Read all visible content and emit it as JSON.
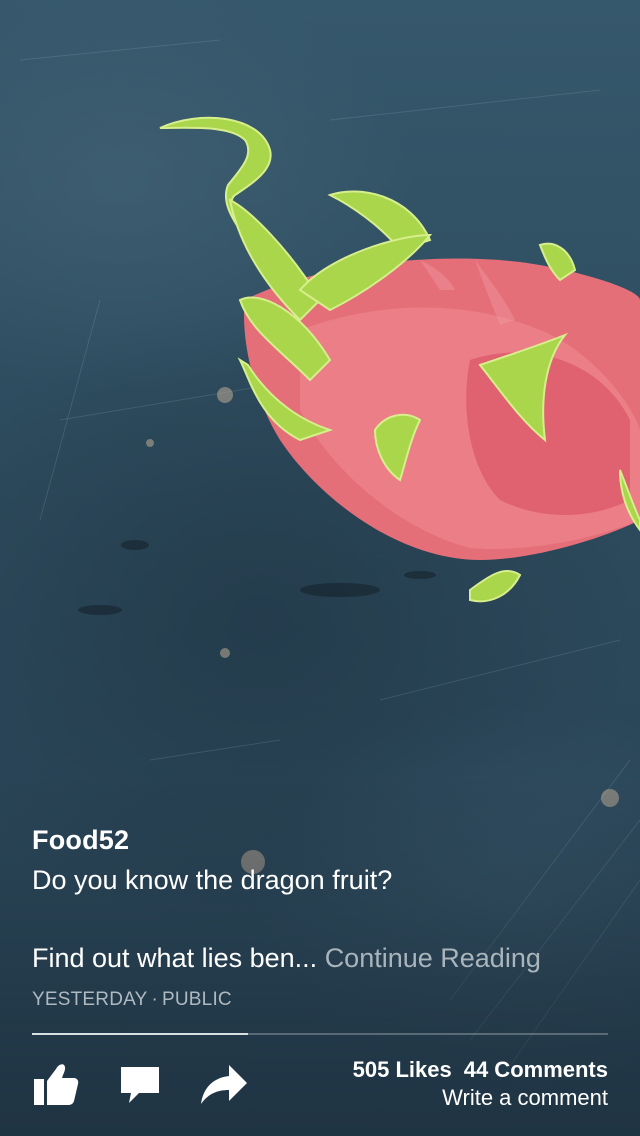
{
  "post": {
    "page_name": "Food52",
    "text": "Do you know the dragon fruit?",
    "excerpt": "Find out what lies ben...",
    "continue_label": "Continue Reading",
    "timestamp": "YESTERDAY",
    "separator": "·",
    "visibility": "PUBLIC"
  },
  "actions": {
    "like_icon": "thumbs-up-icon",
    "comment_icon": "comment-bubble-icon",
    "share_icon": "share-arrow-icon"
  },
  "stats": {
    "likes": "505 Likes",
    "comments": "44 Comments",
    "write_comment": "Write a comment"
  },
  "progress": {
    "read_fraction": 0.375
  },
  "colors": {
    "background": "#2f4656",
    "fruit_skin": "#e0707a",
    "fruit_bracts": "#a8d84a",
    "text": "#ffffff",
    "muted_text": "#aeb9c0"
  }
}
